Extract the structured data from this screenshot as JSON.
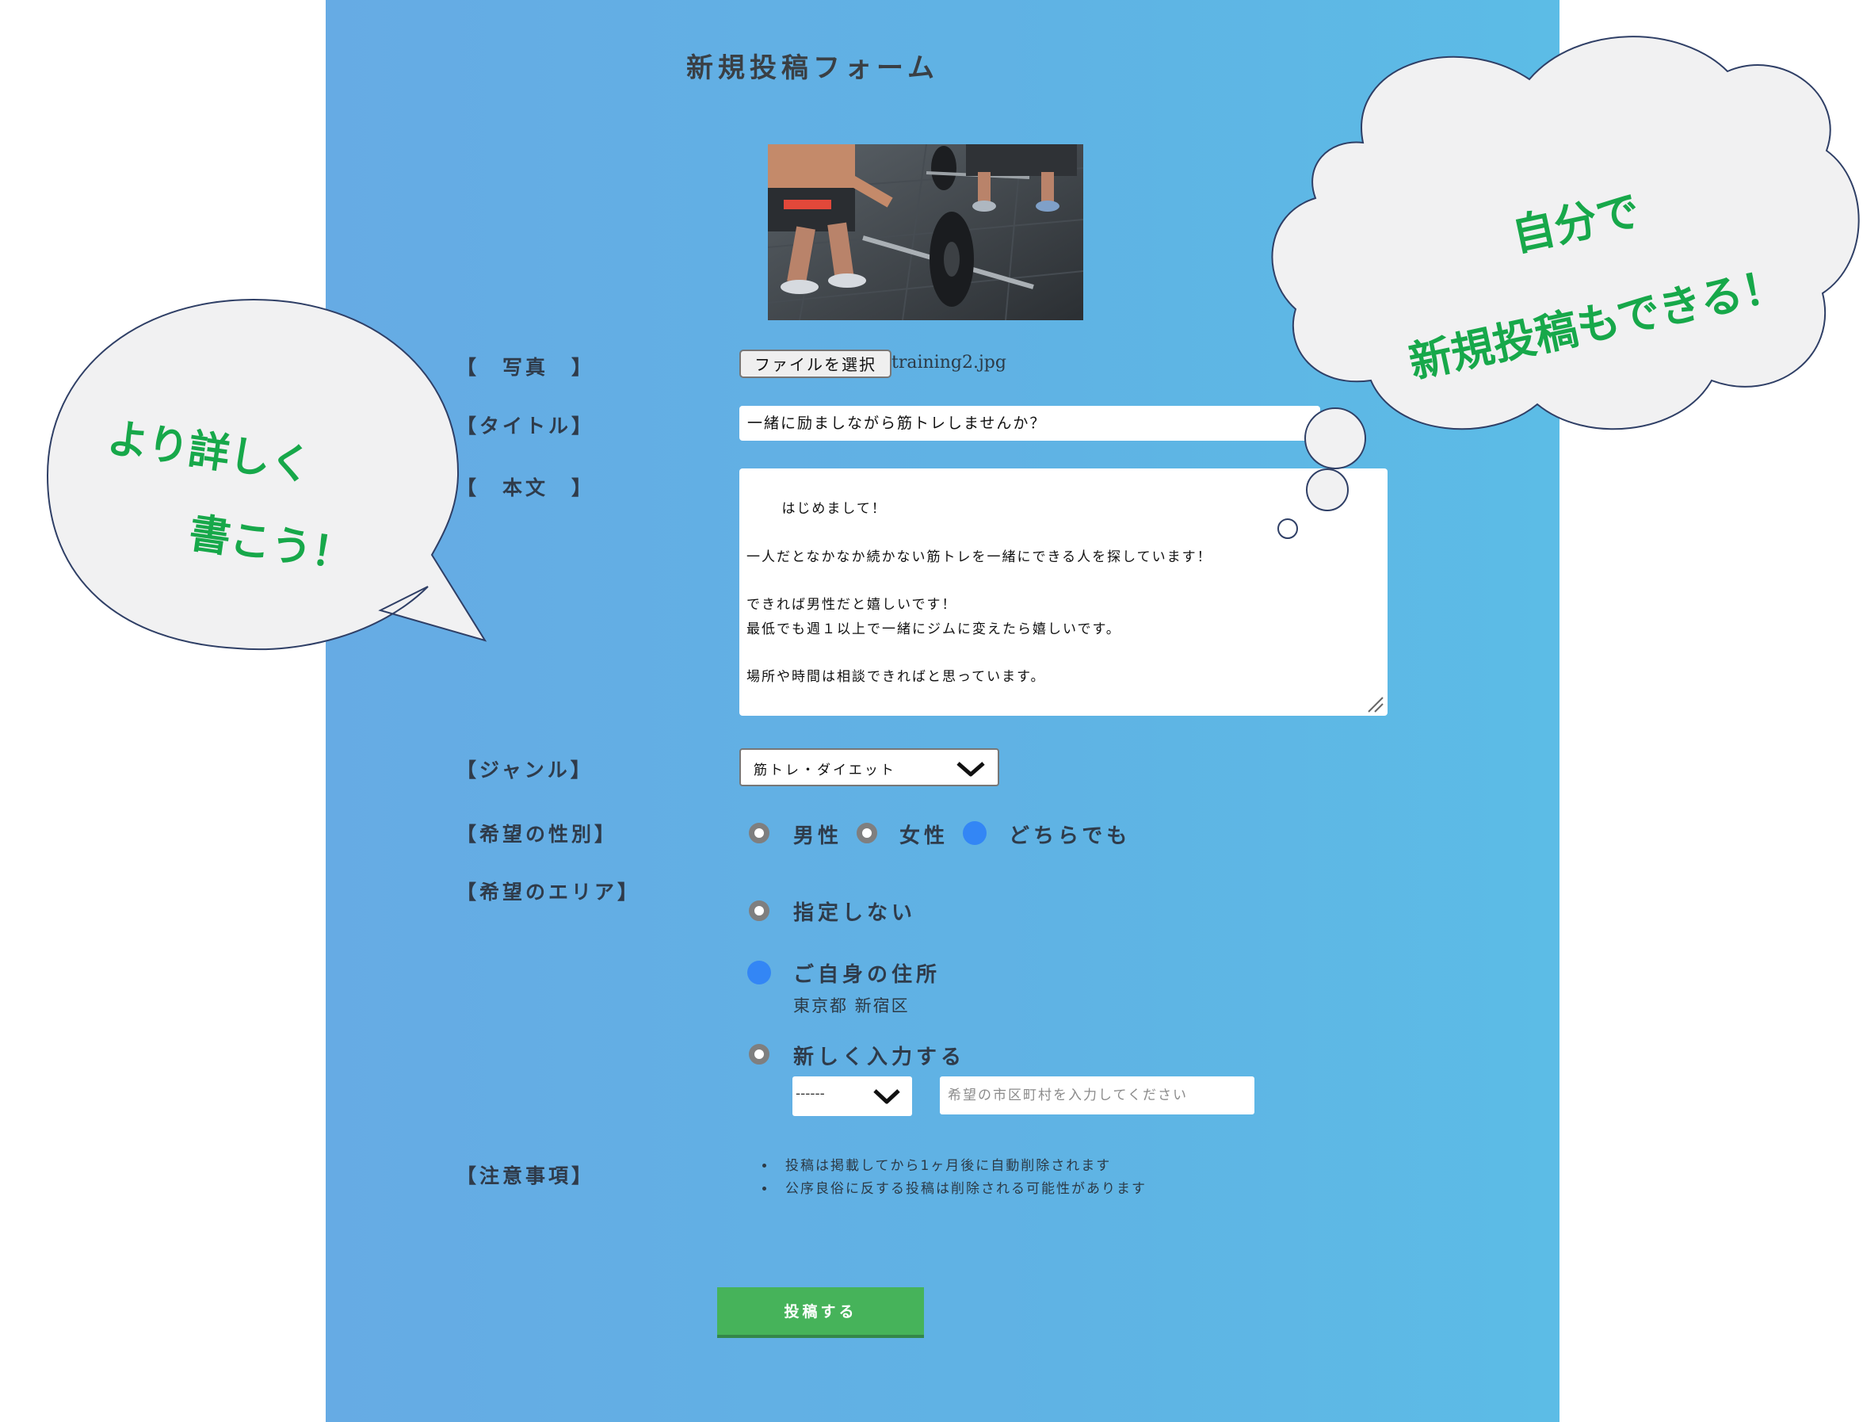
{
  "form": {
    "title": "新規投稿フォーム",
    "labels": {
      "photo": "【　写真　】",
      "title": "【タイトル】",
      "body": "【　本文　】",
      "genre": "【ジャンル】",
      "gender": "【希望の性別】",
      "area": "【希望のエリア】",
      "notes": "【注意事項】"
    },
    "file_button": "ファイルを選択",
    "file_name": "training2.jpg",
    "title_value": "一緒に励ましながら筋トレしませんか？",
    "body_value": "はじめまして！\n\n一人だとなかなか続かない筋トレを一緒にできる人を探しています！\n\nできれば男性だと嬉しいです！\n最低でも週１以上で一緒にジムに変えたら嬉しいです。\n\n場所や時間は相談できればと思っています。\n\nご興味のある方はチャットください！よろしくおねがいします！",
    "genre_selected": "筋トレ・ダイエット",
    "gender_options": [
      {
        "label": "男性",
        "selected": false
      },
      {
        "label": "女性",
        "selected": false
      },
      {
        "label": "どちらでも",
        "selected": true
      }
    ],
    "area_options": {
      "none": {
        "label": "指定しない",
        "selected": false
      },
      "own": {
        "label": "ご自身の住所",
        "selected": true,
        "address": "東京都 新宿区"
      },
      "new": {
        "label": "新しく入力する",
        "selected": false
      }
    },
    "prefecture_selected": "------",
    "city_placeholder": "希望の市区町村を入力してください",
    "notes": [
      "投稿は掲載してから1ヶ月後に自動削除されます",
      "公序良俗に反する投稿は削除される可能性があります"
    ],
    "submit_label": "投稿する"
  },
  "callouts": {
    "left_line1": "より詳しく",
    "left_line2": "書こう！",
    "right_line1": "自分で",
    "right_line2": "新規投稿もできる！"
  },
  "colors": {
    "panel": "#62b0e4",
    "accent_green": "#17a84a",
    "radio_selected": "#3386f5",
    "submit": "#46b35a"
  }
}
